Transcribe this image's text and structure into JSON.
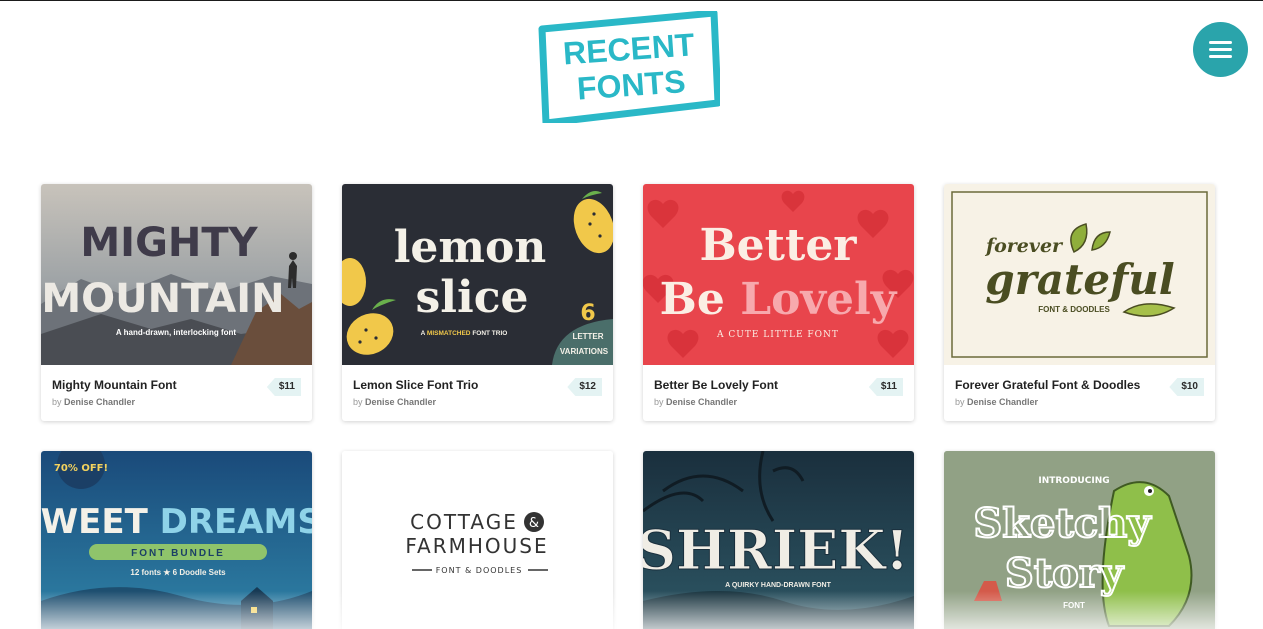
{
  "header": {
    "logo_line1": "RECENT",
    "logo_line2": "FONTS",
    "brand_color": "#2ab8c7"
  },
  "menu": {
    "icon": "hamburger-menu-icon",
    "color": "#2aa4ab"
  },
  "cards": [
    {
      "title": "Mighty Mountain Font",
      "by_prefix": "by",
      "author": "Denise Chandler",
      "price": "$11",
      "art": {
        "line1": "MIGHTY",
        "line2": "MOUNTAIN",
        "tagline": "A hand-drawn, interlocking font"
      }
    },
    {
      "title": "Lemon Slice Font Trio",
      "by_prefix": "by",
      "author": "Denise Chandler",
      "price": "$12",
      "art": {
        "line1": "lemon",
        "line2": "slice",
        "tagline_a": "A",
        "tagline_b": "MISMATCHED",
        "tagline_c": "FONT TRIO",
        "badge_num": "6",
        "badge_line1": "LETTER",
        "badge_line2": "VARIATIONS"
      }
    },
    {
      "title": "Better Be Lovely Font",
      "by_prefix": "by",
      "author": "Denise Chandler",
      "price": "$11",
      "art": {
        "line1": "Better",
        "line2a": "Be",
        "line2b": "Lovely",
        "tagline": "A CUTE LITTLE FONT"
      }
    },
    {
      "title": "Forever Grateful Font & Doodles",
      "by_prefix": "by",
      "author": "Denise Chandler",
      "price": "$10",
      "art": {
        "line1": "forever",
        "line2": "grateful",
        "tagline": "FONT & DOODLES"
      }
    },
    {
      "art": {
        "badge": "70% OFF!",
        "line1a": "SWEET",
        "line1b": "DREAMS",
        "line2": "FONT BUNDLE",
        "tagline": "12 fonts ★ 6 Doodle Sets"
      }
    },
    {
      "art": {
        "line1": "COTTAGE",
        "amp": "&",
        "line2": "FARMHOUSE",
        "tagline": "FONT & DOODLES"
      }
    },
    {
      "art": {
        "line1": "SHRIEK!",
        "tagline": "A QUIRKY HAND-DRAWN FONT"
      }
    },
    {
      "art": {
        "line0": "INTRODUCING",
        "line1": "Sketchy",
        "line2": "Story",
        "tagline": "FONT"
      }
    }
  ]
}
